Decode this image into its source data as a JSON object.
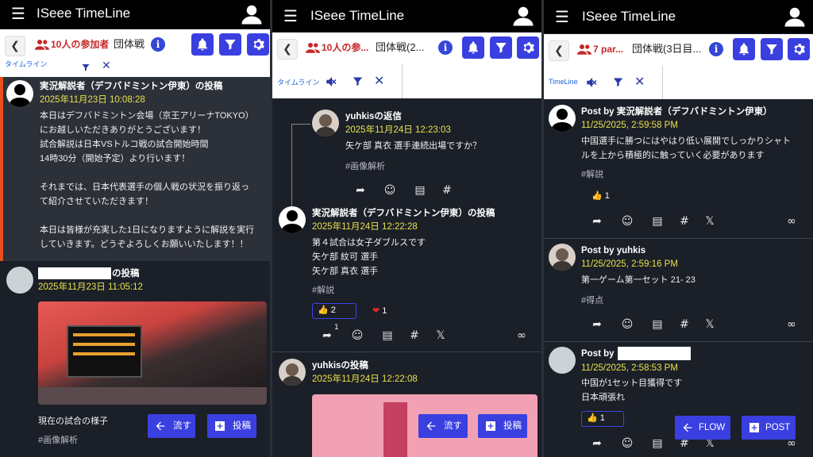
{
  "app_title": "ISeee TimeLine",
  "colors": {
    "accent": "#3a3fe0",
    "time": "#e8e24c",
    "participants": "#c62828",
    "bg": "#1b1f27"
  },
  "panel1": {
    "participants": "10人の参加者",
    "match": "団体戦",
    "filter_label": "タイムライン",
    "posts": [
      {
        "name": "実況解説者（デフバドミントン伊東）の投稿",
        "time": "2025年11月23日 10:08:28",
        "text": "本日はデフバドミントン会場（京王アリーナTOKYO）\nにお越しいただきありがとうございます！\n試合解説は日本VSトルコ戦の試合開始時間\n14時30分（開始予定）より行います！\n\nそれまでは、日本代表選手の個人戦の状況を振り返っ\nて紹介させていただきます！\n\n本日は皆様が充実した1日になりますように解説を実行\nしていきます。どうぞよろしくお願いいたします！！"
      },
      {
        "name": "の投稿",
        "time": "2025年11月23日 11:05:12",
        "text": "現在の試合の様子",
        "tag": "#画像解析"
      }
    ],
    "fab_flow": "流す",
    "fab_post": "投稿"
  },
  "panel2": {
    "participants": "10人の参...",
    "match": "団体戦(2...",
    "filter_label": "タイムライン",
    "posts": [
      {
        "name": "yuhkisの返信",
        "time": "2025年11月24日 12:23:03",
        "text": "矢ケ部 真衣 選手連続出場ですか？",
        "tag": "#画像解析"
      },
      {
        "name": "実況解説者（デフバドミントン伊東）の投稿",
        "time": "2025年11月24日 12:22:28",
        "text": "第４試合は女子ダブルスです\n矢ケ部 紋可 選手\n矢ケ部 真衣 選手",
        "tag": "#解説",
        "thumbs": "2",
        "hearts": "1",
        "shares": "1"
      },
      {
        "name": "yuhkisの投稿",
        "time": "2025年11月24日 12:22:08"
      }
    ],
    "fab_flow": "流す",
    "fab_post": "投稿"
  },
  "panel3": {
    "participants": "7 par...",
    "match": "団体戦(3日目...",
    "filter_label": "TimeLine",
    "posts": [
      {
        "name": "Post by 実況解説者（デフバドミントン伊東）",
        "time": "11/25/2025, 2:59:58 PM",
        "text": "中国選手に勝つにはやはり低い展開でしっかりシャト\nルを上から積極的に触っていく必要があります",
        "tag": "#解説",
        "thumbs": "1"
      },
      {
        "name": "Post by yuhkis",
        "time": "11/25/2025, 2:59:16 PM",
        "text": "第一ゲーム第一セット 21- 23",
        "tag": "#得点"
      },
      {
        "name": "Post by",
        "time": "11/25/2025, 2:58:53 PM",
        "text": "中国が1セット目獲得です\n日本頑張れ",
        "thumbs": "1"
      }
    ],
    "fab_flow": "FLOW",
    "fab_post": "POST"
  }
}
